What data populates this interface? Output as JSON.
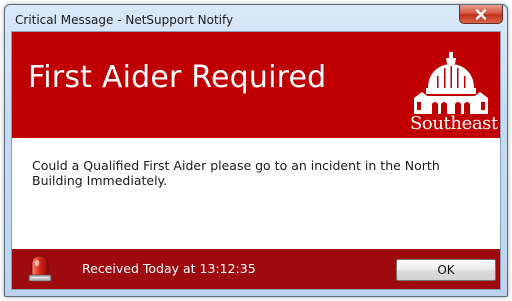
{
  "window": {
    "title": "Critical Message - NetSupport Notify",
    "close_icon": "close-x-icon"
  },
  "header": {
    "heading": "First Aider Required",
    "background_color": "#c00000",
    "logo": {
      "icon": "domed-building-logo",
      "wordmark": "Southeast"
    }
  },
  "message": {
    "text": "Could a Qualified First Aider please go to an incident in the North Building Immediately."
  },
  "footer": {
    "background_color": "#9e0b0f",
    "alert_icon": "red-siren-icon",
    "received_text": "Received Today at 13:12:35",
    "ok_label": "OK"
  }
}
